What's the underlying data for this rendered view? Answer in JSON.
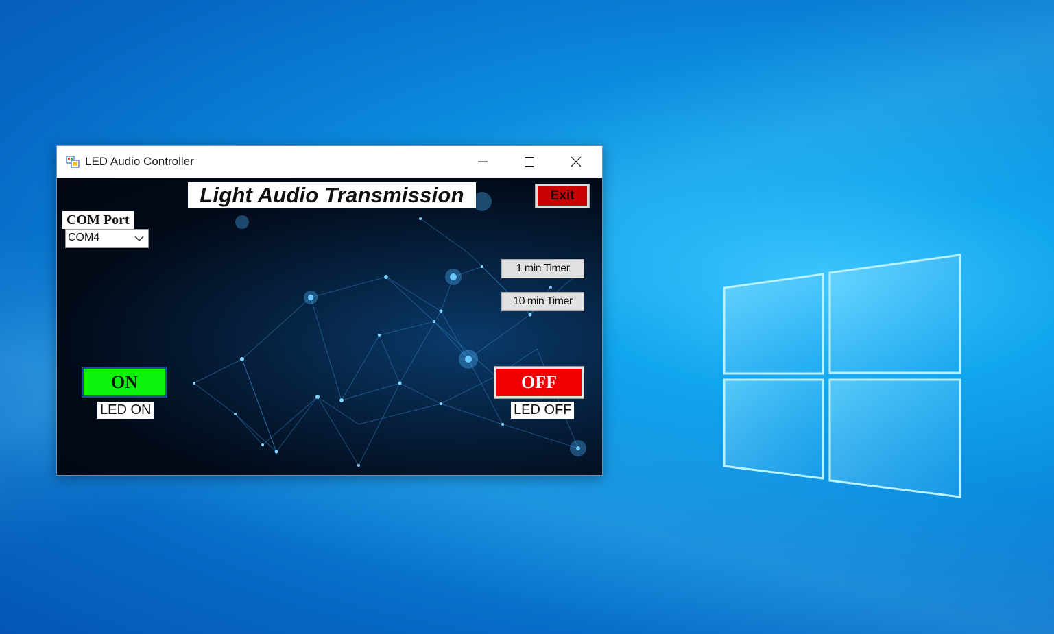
{
  "window": {
    "title": "LED Audio Controller",
    "controls": {
      "minimize": "minimize-icon",
      "maximize": "maximize-icon",
      "close": "close-icon"
    }
  },
  "main": {
    "heading": "Light Audio Transmission",
    "exit_label": "Exit",
    "com_port": {
      "label": "COM Port",
      "selected": "COM4"
    },
    "timers": {
      "one_min": "1 min Timer",
      "ten_min": "10 min Timer"
    },
    "on_button": "ON",
    "off_button": "OFF",
    "led_on_label": "LED ON",
    "led_off_label": "LED OFF"
  },
  "colors": {
    "on_green": "#0cf30c",
    "off_red": "#f20000",
    "exit_red": "#c80000",
    "desktop_blue": "#0a86da"
  }
}
